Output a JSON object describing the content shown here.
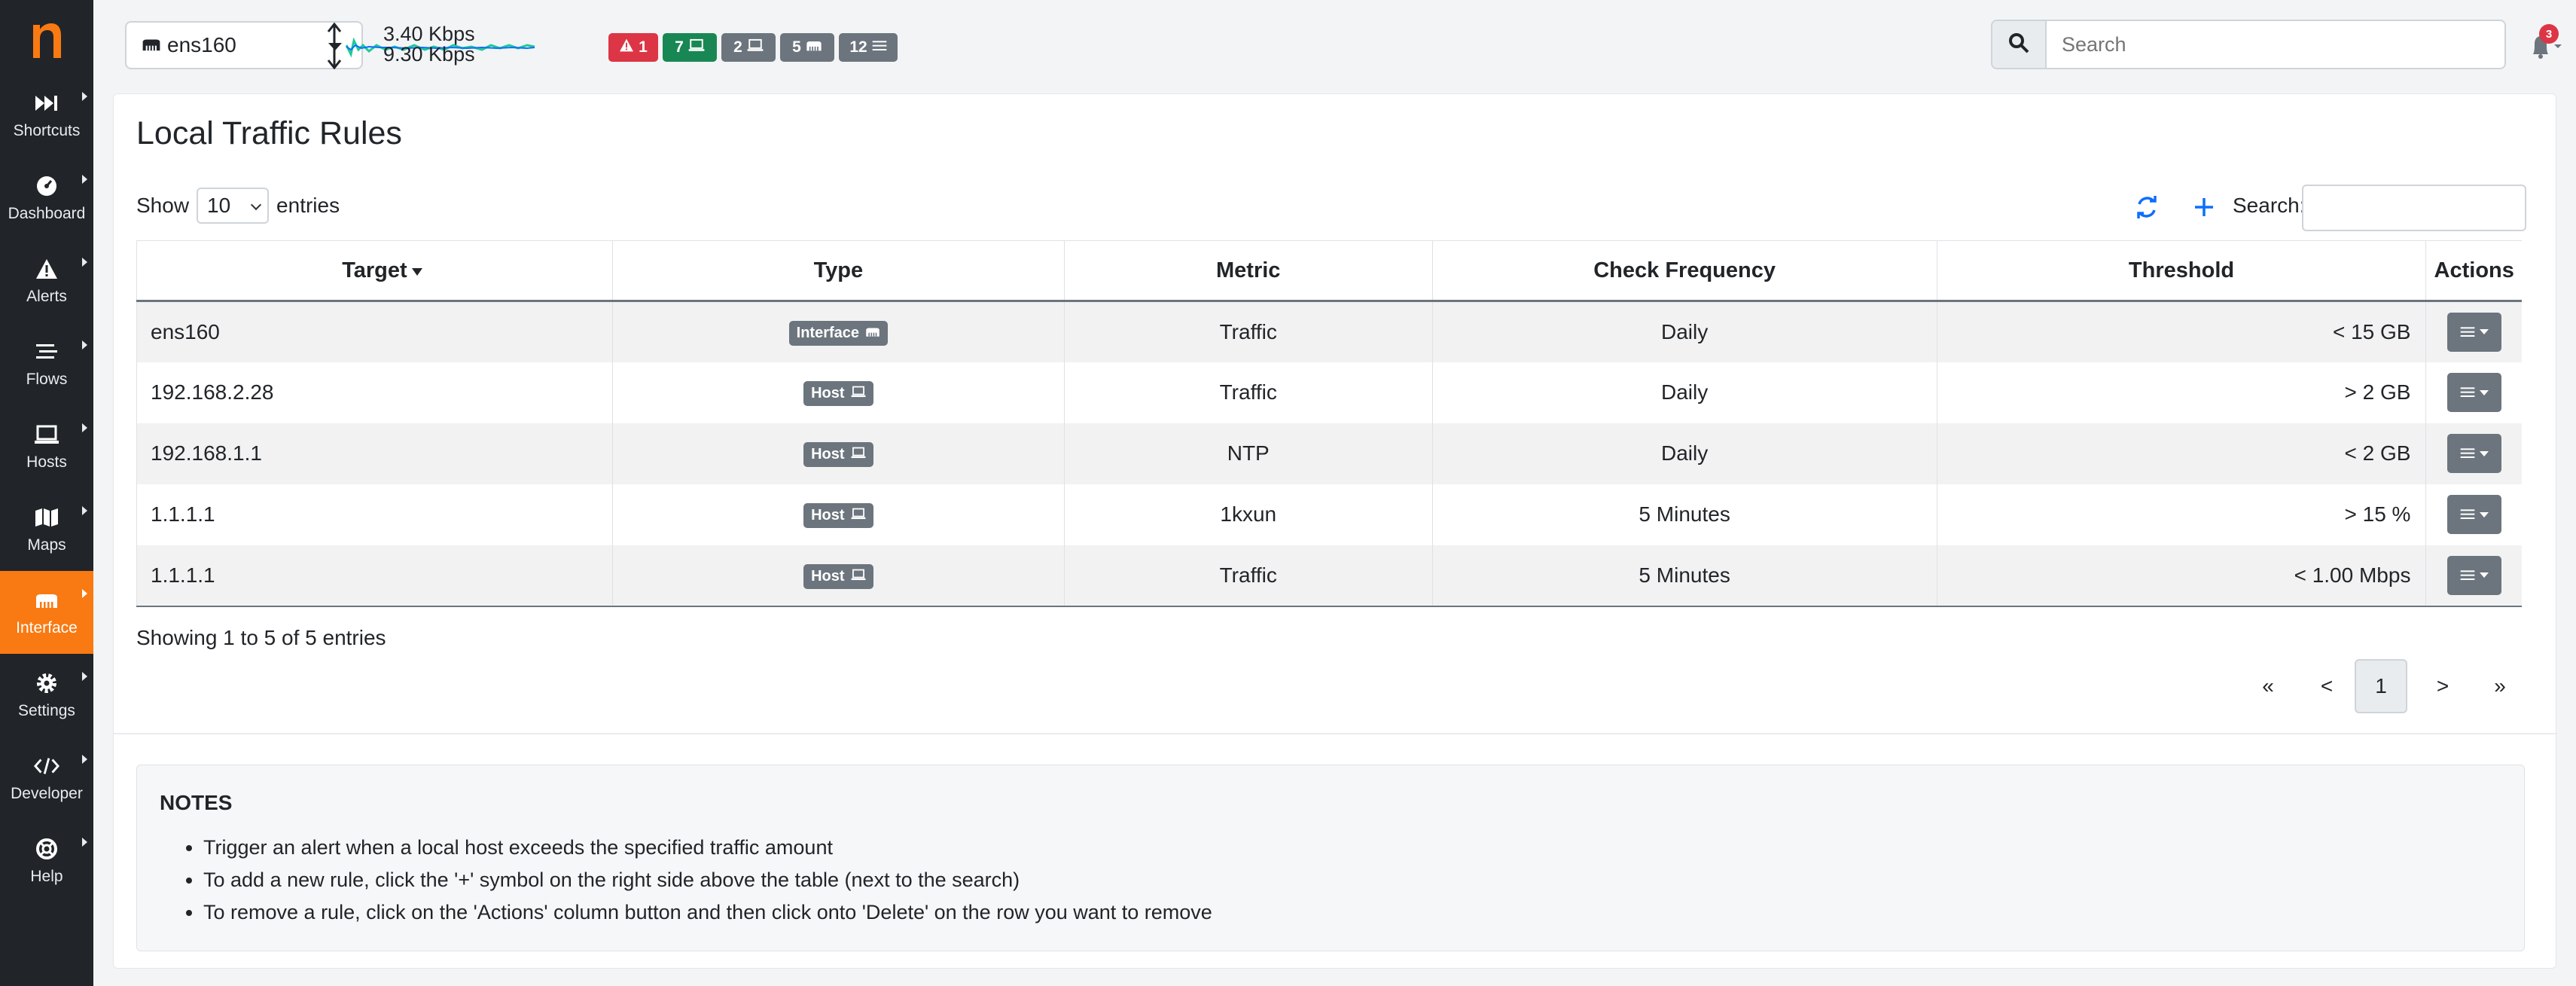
{
  "sidebar": {
    "logo": "n",
    "items": [
      {
        "label": "Shortcuts",
        "icon": "fast-forward-icon",
        "active": false
      },
      {
        "label": "Dashboard",
        "icon": "dashboard-gauge-icon",
        "active": false
      },
      {
        "label": "Alerts",
        "icon": "warning-icon",
        "active": false
      },
      {
        "label": "Flows",
        "icon": "stream-icon",
        "active": false
      },
      {
        "label": "Hosts",
        "icon": "laptop-icon",
        "active": false
      },
      {
        "label": "Maps",
        "icon": "map-icon",
        "active": false
      },
      {
        "label": "Interface",
        "icon": "ethernet-icon",
        "active": true
      },
      {
        "label": "Settings",
        "icon": "gear-icon",
        "active": false
      },
      {
        "label": "Developer",
        "icon": "code-icon",
        "active": false
      },
      {
        "label": "Help",
        "icon": "life-ring-icon",
        "active": false
      }
    ]
  },
  "topbar": {
    "interface": "ens160",
    "throughput_up": "3.40 Kbps",
    "throughput_down": "9.30 Kbps",
    "badges": [
      {
        "count": "1",
        "icon": "warning-icon",
        "color": "#dc3545"
      },
      {
        "count": "7",
        "icon": "laptop-icon",
        "color": "#198754"
      },
      {
        "count": "2",
        "icon": "laptop-icon",
        "color": "#6c757d"
      },
      {
        "count": "5",
        "icon": "ethernet-icon",
        "color": "#6c757d"
      },
      {
        "count": "12",
        "icon": "list-icon",
        "color": "#6c757d"
      }
    ],
    "search_placeholder": "Search",
    "notifications_count": "3"
  },
  "page": {
    "title": "Local Traffic Rules",
    "show_label": "Show",
    "length_value": "10",
    "entries_label": "entries",
    "search_label": "Search:",
    "columns": [
      "Target",
      "Type",
      "Metric",
      "Check Frequency",
      "Threshold",
      "Actions"
    ],
    "rows": [
      {
        "target": "ens160",
        "type": "Interface",
        "type_icon": "ethernet-icon",
        "metric": "Traffic",
        "frequency": "Daily",
        "threshold": "< 15 GB"
      },
      {
        "target": "192.168.2.28",
        "type": "Host",
        "type_icon": "laptop-icon",
        "metric": "Traffic",
        "frequency": "Daily",
        "threshold": "> 2 GB"
      },
      {
        "target": "192.168.1.1",
        "type": "Host",
        "type_icon": "laptop-icon",
        "metric": "NTP",
        "frequency": "Daily",
        "threshold": "< 2 GB"
      },
      {
        "target": "1.1.1.1",
        "type": "Host",
        "type_icon": "laptop-icon",
        "metric": "1kxun",
        "frequency": "5 Minutes",
        "threshold": "> 15 %"
      },
      {
        "target": "1.1.1.1",
        "type": "Host",
        "type_icon": "laptop-icon",
        "metric": "Traffic",
        "frequency": "5 Minutes",
        "threshold": "< 1.00 Mbps"
      }
    ],
    "info": "Showing 1 to 5 of 5 entries",
    "pagination": {
      "first": "«",
      "prev": "<",
      "current": "1",
      "next": ">",
      "last": "»"
    }
  },
  "notes": {
    "title": "NOTES",
    "items": [
      "Trigger an alert when a local host exceeds the specified traffic amount",
      "To add a new rule, click the '+' symbol on the right side above the table (next to the search)",
      "To remove a rule, click on the 'Actions' column button and then click onto 'Delete' on the row you want to remove"
    ]
  },
  "colors": {
    "sidebar_bg": "#212529",
    "accent": "#f97a12",
    "link_blue": "#0d6efd",
    "badge_gray": "#6c757d"
  }
}
